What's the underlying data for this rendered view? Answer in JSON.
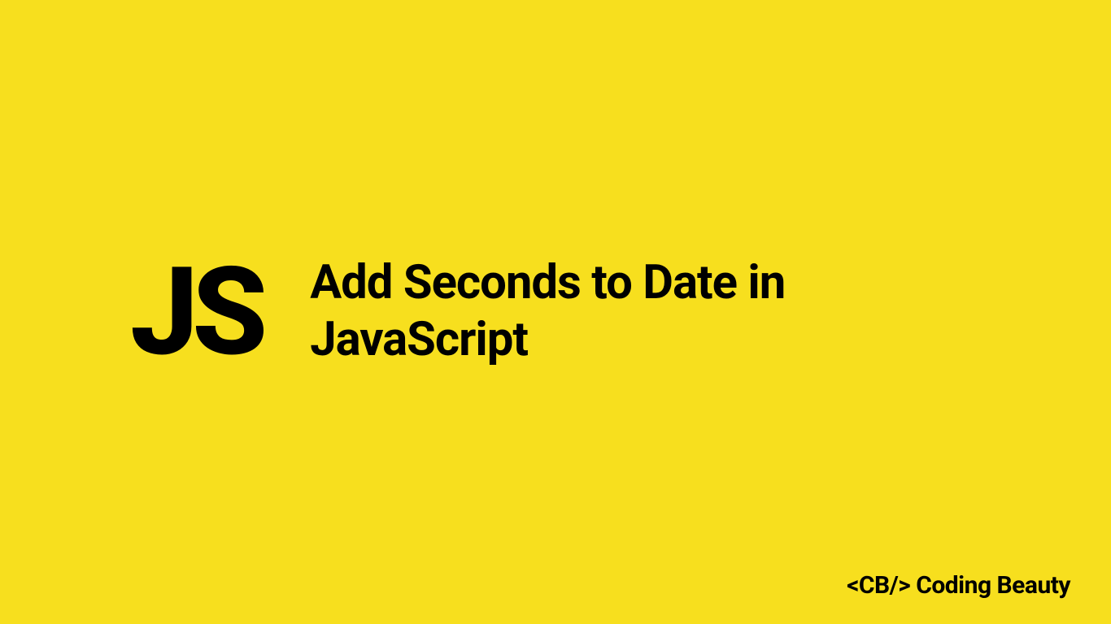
{
  "logo": {
    "text": "JS"
  },
  "title": "Add Seconds to Date in JavaScript",
  "brand": "<CB/> Coding Beauty",
  "colors": {
    "background": "#f7df1e",
    "text": "#000000"
  }
}
